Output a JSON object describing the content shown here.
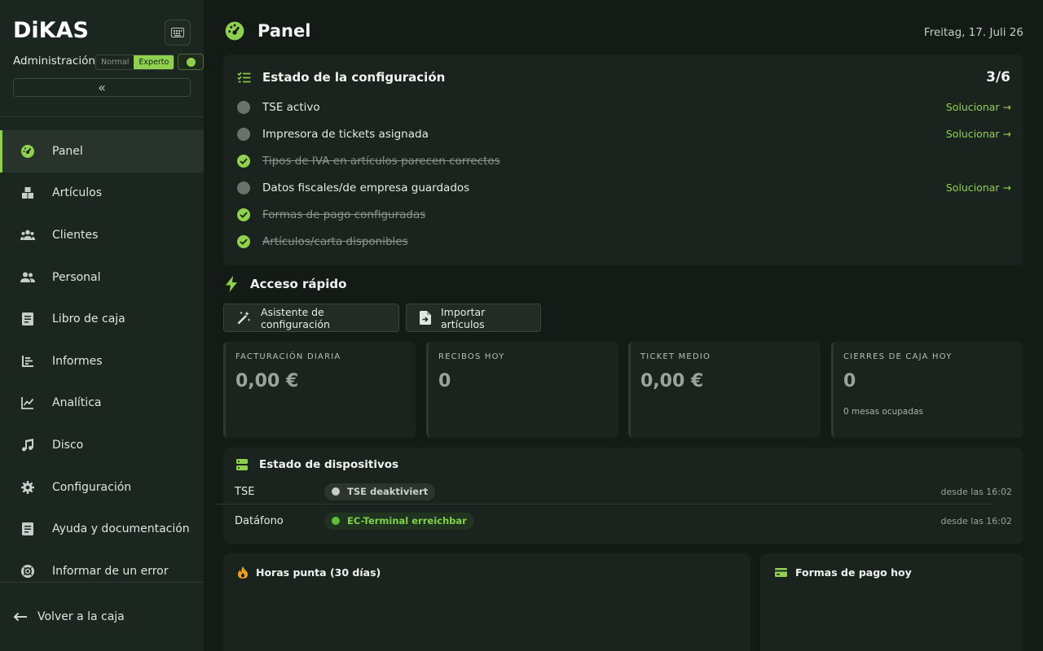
{
  "brand": {
    "logo": "DiKAS",
    "accent": "#8fd14f"
  },
  "sidebar": {
    "section_label": "Administración",
    "mode_normal": "Normal",
    "mode_expert": "Experto",
    "collapse_icon": "«",
    "items": [
      {
        "label": "Panel",
        "icon": "dashboard-icon",
        "active": true
      },
      {
        "label": "Artículos",
        "icon": "boxes-icon"
      },
      {
        "label": "Clientes",
        "icon": "people-icon"
      },
      {
        "label": "Personal",
        "icon": "staff-icon"
      },
      {
        "label": "Libro de caja",
        "icon": "cashbook-icon"
      },
      {
        "label": "Informes",
        "icon": "reports-icon"
      },
      {
        "label": "Analítica",
        "icon": "analytics-icon"
      },
      {
        "label": "Disco",
        "icon": "music-icon"
      },
      {
        "label": "Configuración",
        "icon": "gear-icon"
      },
      {
        "label": "Ayuda y documentación",
        "icon": "docs-icon"
      },
      {
        "label": "Informar de un error",
        "icon": "lifebuoy-icon"
      }
    ],
    "back_label": "Volver a la caja"
  },
  "header": {
    "title": "Panel",
    "date": "Freitag, 17. Juli 26"
  },
  "setup": {
    "title": "Estado de la configuración",
    "count": "3/6",
    "fix_label": "Solucionar →",
    "items": [
      {
        "label": "TSE activo",
        "done": false
      },
      {
        "label": "Impresora de tickets asignada",
        "done": false
      },
      {
        "label": "Tipos de IVA en artículos parecen correctos",
        "done": true
      },
      {
        "label": "Datos fiscales/de empresa guardados",
        "done": false
      },
      {
        "label": "Formas de pago configuradas",
        "done": true
      },
      {
        "label": "Artículos/carta disponibles",
        "done": true
      }
    ]
  },
  "quick": {
    "title": "Acceso rápido",
    "wizard_label": "Asistente de configuración",
    "import_label": "Importar artículos"
  },
  "kpis": [
    {
      "label": "FACTURACIÓN DIARIA",
      "value": "0,00 €"
    },
    {
      "label": "RECIBOS HOY",
      "value": "0"
    },
    {
      "label": "TICKET MEDIO",
      "value": "0,00 €"
    },
    {
      "label": "CIERRES DE CAJA HOY",
      "value": "0",
      "sub": "0 mesas ocupadas"
    }
  ],
  "devices": {
    "title": "Estado de dispositivos",
    "rows": [
      {
        "name": "TSE",
        "status": "TSE deaktiviert",
        "state": "off",
        "since": "desde las 16:02"
      },
      {
        "name": "Datáfono",
        "status": "EC-Terminal erreichbar",
        "state": "on",
        "since": "desde las 16:02"
      }
    ]
  },
  "peak": {
    "title": "Horas punta (30 días)"
  },
  "payments": {
    "title": "Formas de pago hoy"
  }
}
